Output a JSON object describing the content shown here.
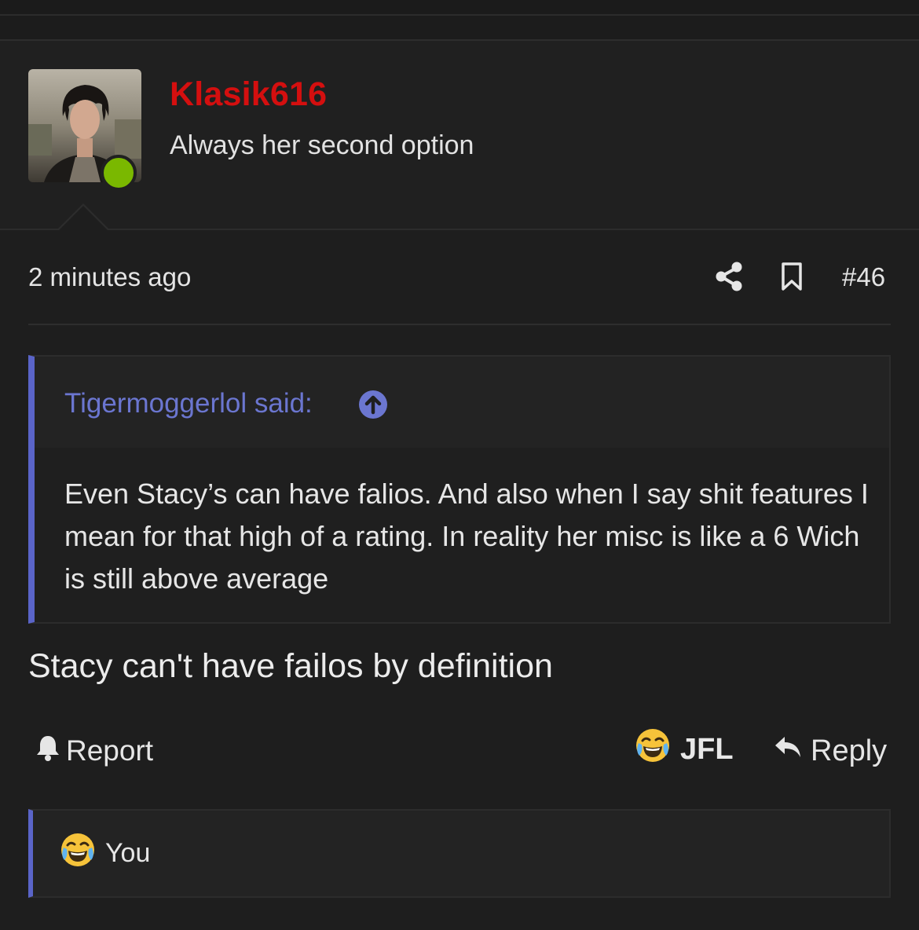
{
  "post": {
    "author": "Klasik616",
    "author_title": "Always her second option",
    "time": "2 minutes ago",
    "number": "#46",
    "message": "Stacy can't have failos by definition"
  },
  "quote": {
    "author_label": "Tigermoggerlol said:",
    "body": "Even Stacy’s can have falios. And also when I say shit features I mean for that high of a rating. In reality her misc is like a 6 Wich is still above average"
  },
  "actions": {
    "report": "Report",
    "reaction_label": "JFL",
    "reply": "Reply"
  },
  "reactions_bar": {
    "users": "You"
  },
  "colors": {
    "username": "#d40f0f",
    "accent": "#5a64c8",
    "online": "#7ab800",
    "background": "#1e1e1e"
  },
  "icons": [
    "share-icon",
    "bookmark-icon",
    "arrow-up-circle-icon",
    "bell-icon",
    "laughing-crying-emoji-icon",
    "reply-arrow-icon"
  ]
}
